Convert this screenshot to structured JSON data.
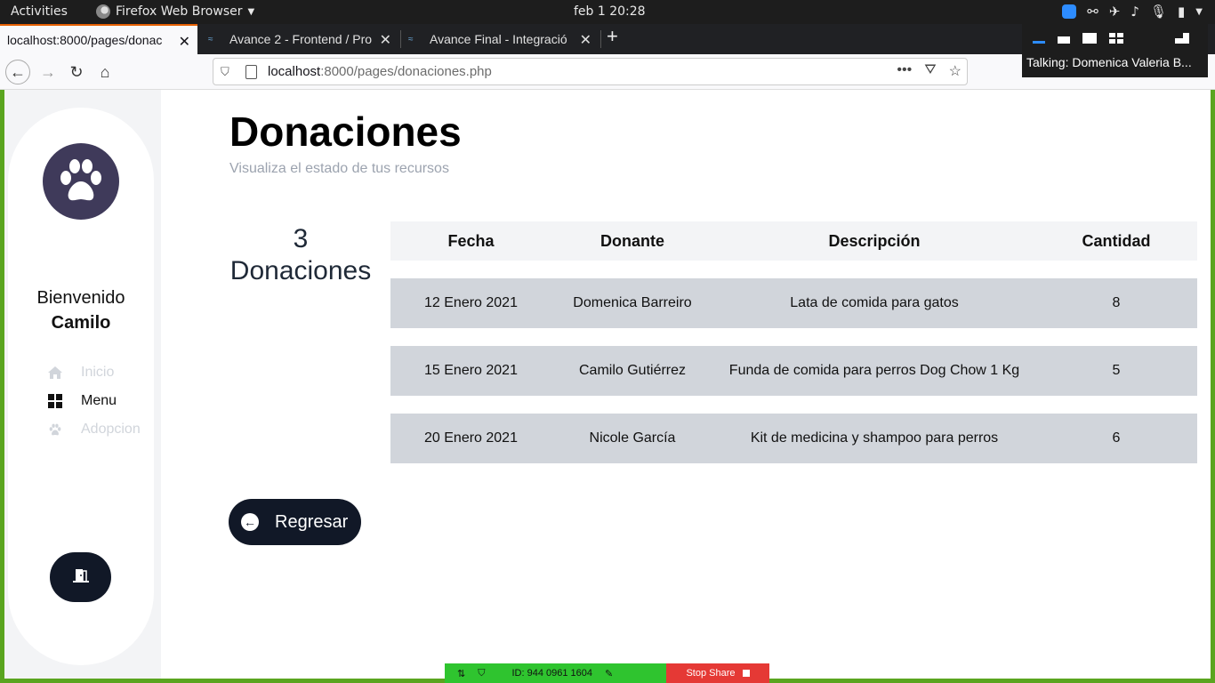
{
  "system": {
    "activities": "Activities",
    "app_name": "Firefox Web Browser",
    "clock": "feb 1  20:28"
  },
  "browser": {
    "tabs": [
      {
        "title": "localhost:8000/pages/donac",
        "active": true
      },
      {
        "title": "Avance 2 - Frontend / Pro",
        "active": false
      },
      {
        "title": "Avance Final - Integració",
        "active": false
      }
    ],
    "url_host": "localhost",
    "url_rest": ":8000/pages/donaciones.php"
  },
  "zoom": {
    "talking": "Talking: Domenica Valeria B...",
    "meeting_id": "ID: 944 0961 1604",
    "stop_share": "Stop Share"
  },
  "sidebar": {
    "welcome": "Bienvenido",
    "user_name": "Camilo",
    "items": [
      {
        "label": "Inicio",
        "icon": "home-icon",
        "current": false
      },
      {
        "label": "Menu",
        "icon": "grid-icon",
        "current": true
      },
      {
        "label": "Adopcion",
        "icon": "paw-icon",
        "current": false
      }
    ]
  },
  "main": {
    "title": "Donaciones",
    "subtitle": "Visualiza el estado de tus recursos",
    "count_number": "3",
    "count_label": "Donaciones",
    "columns": [
      "Fecha",
      "Donante",
      "Descripción",
      "Cantidad"
    ],
    "rows": [
      {
        "fecha": "12 Enero 2021",
        "donante": "Domenica Barreiro",
        "descripcion": "Lata de comida para gatos",
        "cantidad": "8"
      },
      {
        "fecha": "15 Enero 2021",
        "donante": "Camilo Gutiérrez",
        "descripcion": "Funda de comida para perros Dog Chow 1 Kg",
        "cantidad": "5"
      },
      {
        "fecha": "20 Enero 2021",
        "donante": "Nicole García",
        "descripcion": "Kit de medicina y shampoo para perros",
        "cantidad": "6"
      }
    ],
    "back_label": "Regresar"
  },
  "colors": {
    "sidebar_bg": "#f3f4f6",
    "dark_button": "#111827",
    "logo_bg": "#3f3a5a",
    "row_bg": "#d1d5db",
    "header_bg": "#f3f4f6",
    "desktop_frame": "#5aa51f"
  }
}
